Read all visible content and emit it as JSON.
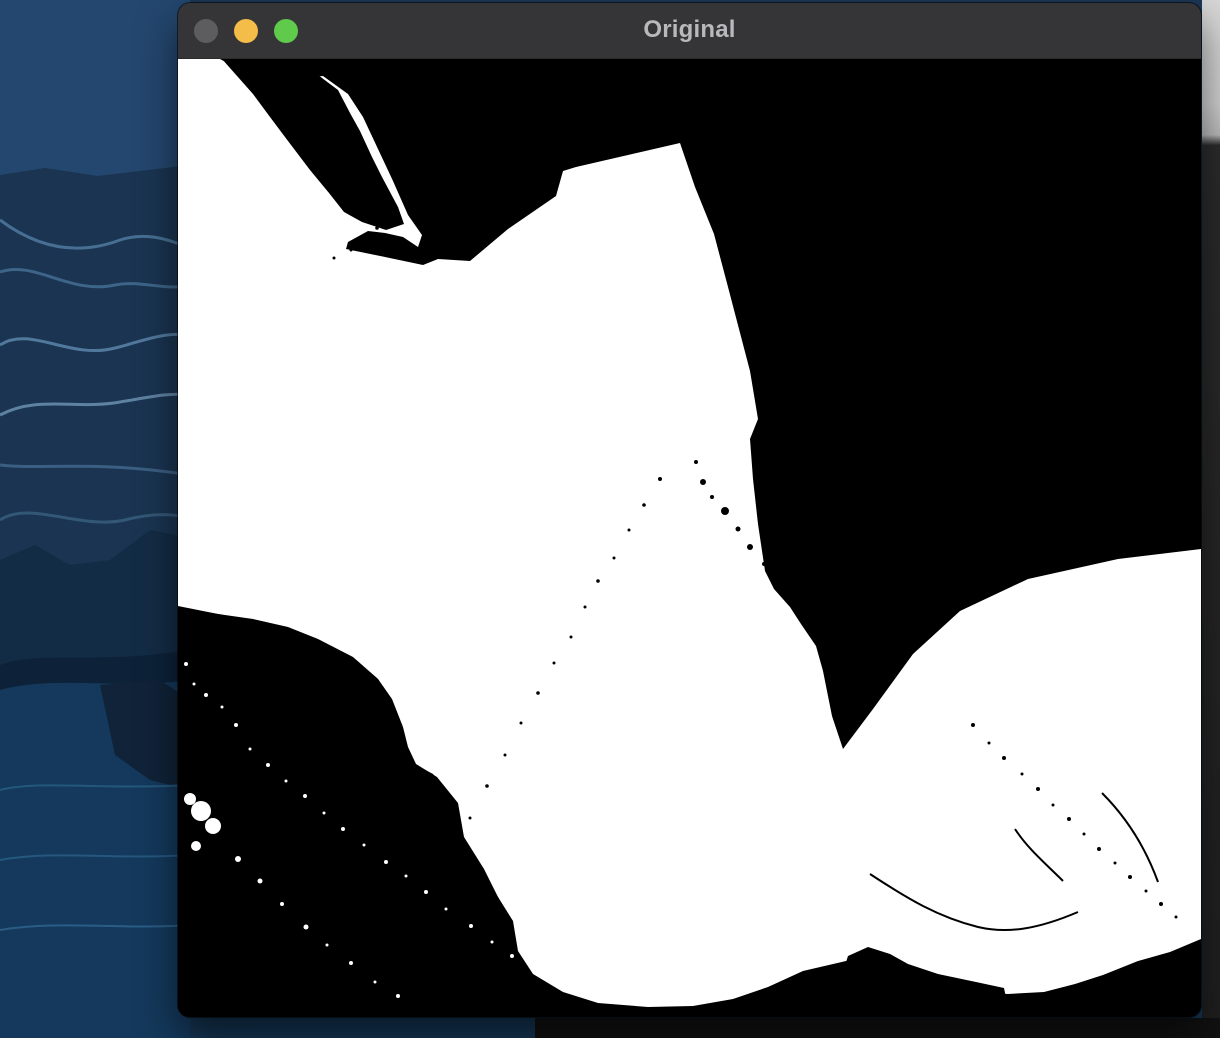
{
  "window": {
    "title": "Original"
  },
  "controls": {
    "close": "close",
    "minimize": "minimize",
    "zoom": "zoom"
  },
  "colors": {
    "titlebar": "#353537",
    "close": "#5d5d5f",
    "minimize": "#f4bc48",
    "zoom": "#5fca4b",
    "image_black": "#000000",
    "image_white": "#ffffff"
  }
}
